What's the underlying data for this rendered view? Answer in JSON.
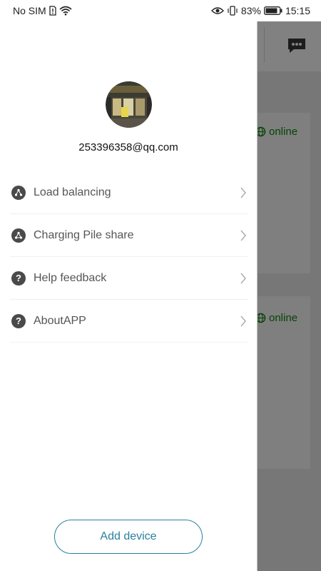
{
  "statusbar": {
    "carrier": "No SIM",
    "battery": "83%",
    "time": "15:15"
  },
  "background": {
    "devices": [
      {
        "status": "online"
      },
      {
        "status": "online"
      }
    ]
  },
  "drawer": {
    "email": "253396358@qq.com",
    "menu": [
      {
        "label": "Load balancing",
        "icon": "load-balance-icon"
      },
      {
        "label": "Charging Pile share",
        "icon": "share-icon"
      },
      {
        "label": "Help feedback",
        "icon": "help-icon"
      },
      {
        "label": "AboutAPP",
        "icon": "help-icon"
      }
    ],
    "add_device": "Add device"
  },
  "colors": {
    "accent": "#2a7fa0",
    "online": "#0b7a0b"
  }
}
